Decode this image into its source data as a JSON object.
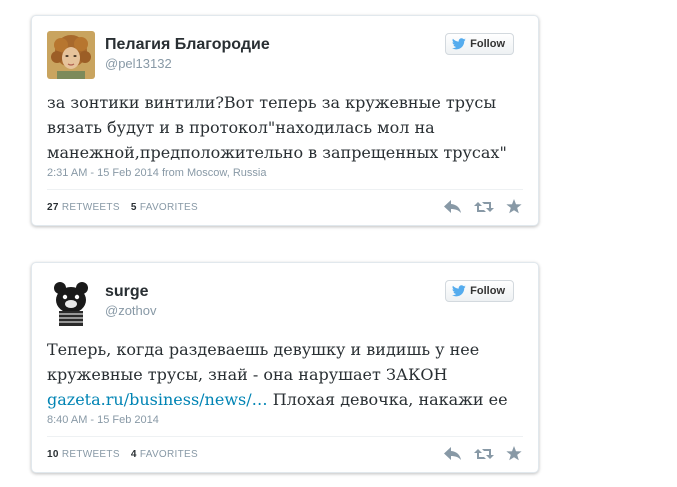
{
  "tweets": [
    {
      "name": "Пелагия Благородие",
      "handle": "@pel13132",
      "follow_label": "Follow",
      "text": "за зонтики винтили?Вот теперь за кружевные трусы\nвязать будут и в протокол\"находилась мол на\nманежной,предположительно в запрещенных трусах\"",
      "timestamp": "2:31 AM - 15 Feb 2014 from Moscow, Russia",
      "retweets_count": "27",
      "retweets_label": "RETWEETS",
      "favorites_count": "5",
      "favorites_label": "FAVORITES"
    },
    {
      "name": "surge",
      "handle": "@zothov",
      "follow_label": "Follow",
      "text_part1": "Теперь, когда раздеваешь девушку и видишь у нее\nкружевные трусы, знай - она нарушает ЗАКОН\n",
      "link": "gazeta.ru/business/news/…",
      "text_part2": " Плохая девочка, накажи ее",
      "timestamp": "8:40 AM - 15 Feb 2014",
      "retweets_count": "10",
      "retweets_label": "RETWEETS",
      "favorites_count": "4",
      "favorites_label": "FAVORITES"
    }
  ],
  "icons": {
    "follow": "twitter-bird-icon",
    "reply": "reply-icon",
    "retweet": "retweet-icon",
    "favorite": "star-icon"
  },
  "colors": {
    "link": "#0084b4",
    "twitter_blue": "#55acee",
    "muted": "#8899a6"
  }
}
